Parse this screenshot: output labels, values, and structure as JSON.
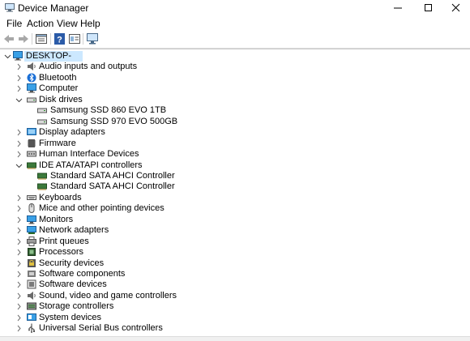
{
  "window": {
    "title": "Device Manager",
    "minimize": "—",
    "maximize": "☐",
    "close": "✕"
  },
  "menu": [
    "File",
    "Action",
    "View",
    "Help"
  ],
  "toolbar": [
    "back-icon",
    "forward-icon",
    "properties-icon",
    "help-icon",
    "view-icon",
    "monitor-icon"
  ],
  "tree": {
    "root": "DESKTOP-",
    "items": [
      {
        "label": "Audio inputs and outputs",
        "icon": "speaker-icon",
        "expanded": false
      },
      {
        "label": "Bluetooth",
        "icon": "bluetooth-icon",
        "expanded": false
      },
      {
        "label": "Computer",
        "icon": "computer-icon",
        "expanded": false
      },
      {
        "label": "Disk drives",
        "icon": "disk-drive-icon",
        "expanded": true,
        "children": [
          {
            "label": "Samsung SSD 860 EVO 1TB",
            "icon": "disk-drive-icon"
          },
          {
            "label": "Samsung SSD 970 EVO 500GB",
            "icon": "disk-drive-icon"
          }
        ]
      },
      {
        "label": "Display adapters",
        "icon": "display-adapter-icon",
        "expanded": false
      },
      {
        "label": "Firmware",
        "icon": "firmware-icon",
        "expanded": false
      },
      {
        "label": "Human Interface Devices",
        "icon": "hid-icon",
        "expanded": false
      },
      {
        "label": "IDE ATA/ATAPI controllers",
        "icon": "ide-controller-icon",
        "expanded": true,
        "children": [
          {
            "label": "Standard SATA AHCI Controller",
            "icon": "ide-controller-icon"
          },
          {
            "label": "Standard SATA AHCI Controller",
            "icon": "ide-controller-icon"
          }
        ]
      },
      {
        "label": "Keyboards",
        "icon": "keyboard-icon",
        "expanded": false
      },
      {
        "label": "Mice and other pointing devices",
        "icon": "mouse-icon",
        "expanded": false
      },
      {
        "label": "Monitors",
        "icon": "monitor-icon",
        "expanded": false
      },
      {
        "label": "Network adapters",
        "icon": "network-adapter-icon",
        "expanded": false
      },
      {
        "label": "Print queues",
        "icon": "printer-icon",
        "expanded": false
      },
      {
        "label": "Processors",
        "icon": "processor-icon",
        "expanded": false
      },
      {
        "label": "Security devices",
        "icon": "security-device-icon",
        "expanded": false
      },
      {
        "label": "Software components",
        "icon": "software-component-icon",
        "expanded": false
      },
      {
        "label": "Software devices",
        "icon": "software-device-icon",
        "expanded": false
      },
      {
        "label": "Sound, video and game controllers",
        "icon": "speaker-icon",
        "expanded": false
      },
      {
        "label": "Storage controllers",
        "icon": "storage-controller-icon",
        "expanded": false
      },
      {
        "label": "System devices",
        "icon": "system-device-icon",
        "expanded": false
      },
      {
        "label": "Universal Serial Bus controllers",
        "icon": "usb-icon",
        "expanded": false
      }
    ]
  },
  "colors": {
    "selection": "#cce8ff",
    "chevron": "#707070",
    "folder_blue": "#3a7bd5"
  }
}
